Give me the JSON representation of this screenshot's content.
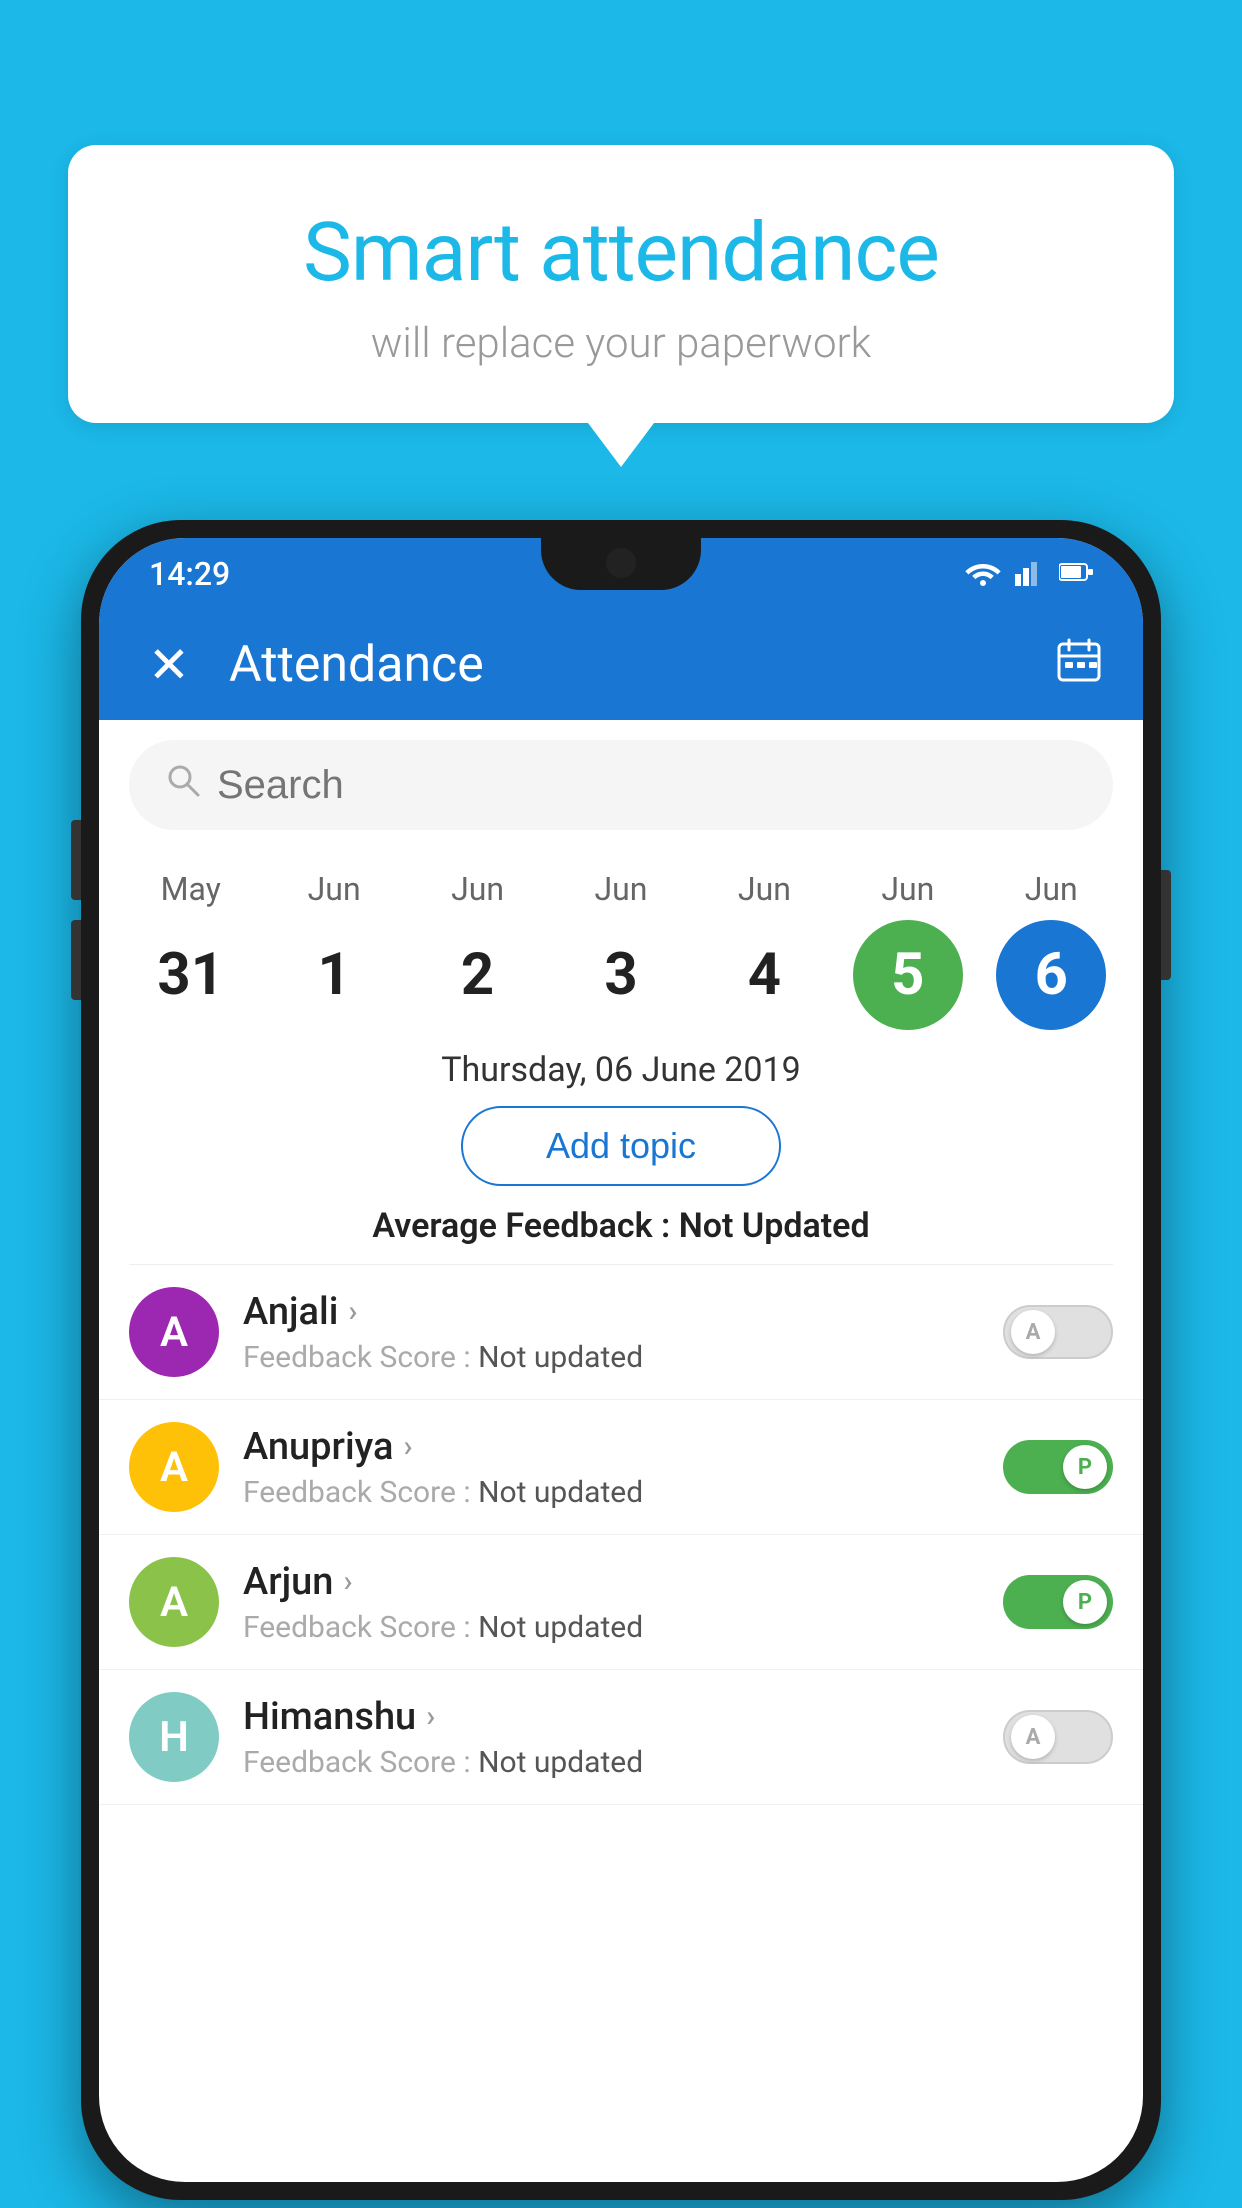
{
  "background_color": "#1BB8E8",
  "bubble": {
    "title": "Smart attendance",
    "subtitle": "will replace your paperwork"
  },
  "status_bar": {
    "time": "14:29",
    "wifi": "▲",
    "signal": "◀",
    "battery": "▌"
  },
  "app_bar": {
    "title": "Attendance",
    "close_icon": "close",
    "calendar_icon": "calendar"
  },
  "search": {
    "placeholder": "Search"
  },
  "calendar": {
    "days": [
      {
        "month": "May",
        "date": "31",
        "state": "normal"
      },
      {
        "month": "Jun",
        "date": "1",
        "state": "normal"
      },
      {
        "month": "Jun",
        "date": "2",
        "state": "normal"
      },
      {
        "month": "Jun",
        "date": "3",
        "state": "normal"
      },
      {
        "month": "Jun",
        "date": "4",
        "state": "normal"
      },
      {
        "month": "Jun",
        "date": "5",
        "state": "today"
      },
      {
        "month": "Jun",
        "date": "6",
        "state": "selected"
      }
    ]
  },
  "date_label": "Thursday, 06 June 2019",
  "add_topic_label": "Add topic",
  "avg_feedback_label": "Average Feedback : ",
  "avg_feedback_value": "Not Updated",
  "students": [
    {
      "name": "Anjali",
      "avatar_letter": "A",
      "avatar_color": "purple",
      "feedback_label": "Feedback Score : ",
      "feedback_value": "Not updated",
      "toggle_state": "off",
      "toggle_label": "A"
    },
    {
      "name": "Anupriya",
      "avatar_letter": "A",
      "avatar_color": "yellow",
      "feedback_label": "Feedback Score : ",
      "feedback_value": "Not updated",
      "toggle_state": "on",
      "toggle_label": "P"
    },
    {
      "name": "Arjun",
      "avatar_letter": "A",
      "avatar_color": "green-light",
      "feedback_label": "Feedback Score : ",
      "feedback_value": "Not updated",
      "toggle_state": "on",
      "toggle_label": "P"
    },
    {
      "name": "Himanshu",
      "avatar_letter": "H",
      "avatar_color": "teal",
      "feedback_label": "Feedback Score : ",
      "feedback_value": "Not updated",
      "toggle_state": "off",
      "toggle_label": "A"
    }
  ]
}
